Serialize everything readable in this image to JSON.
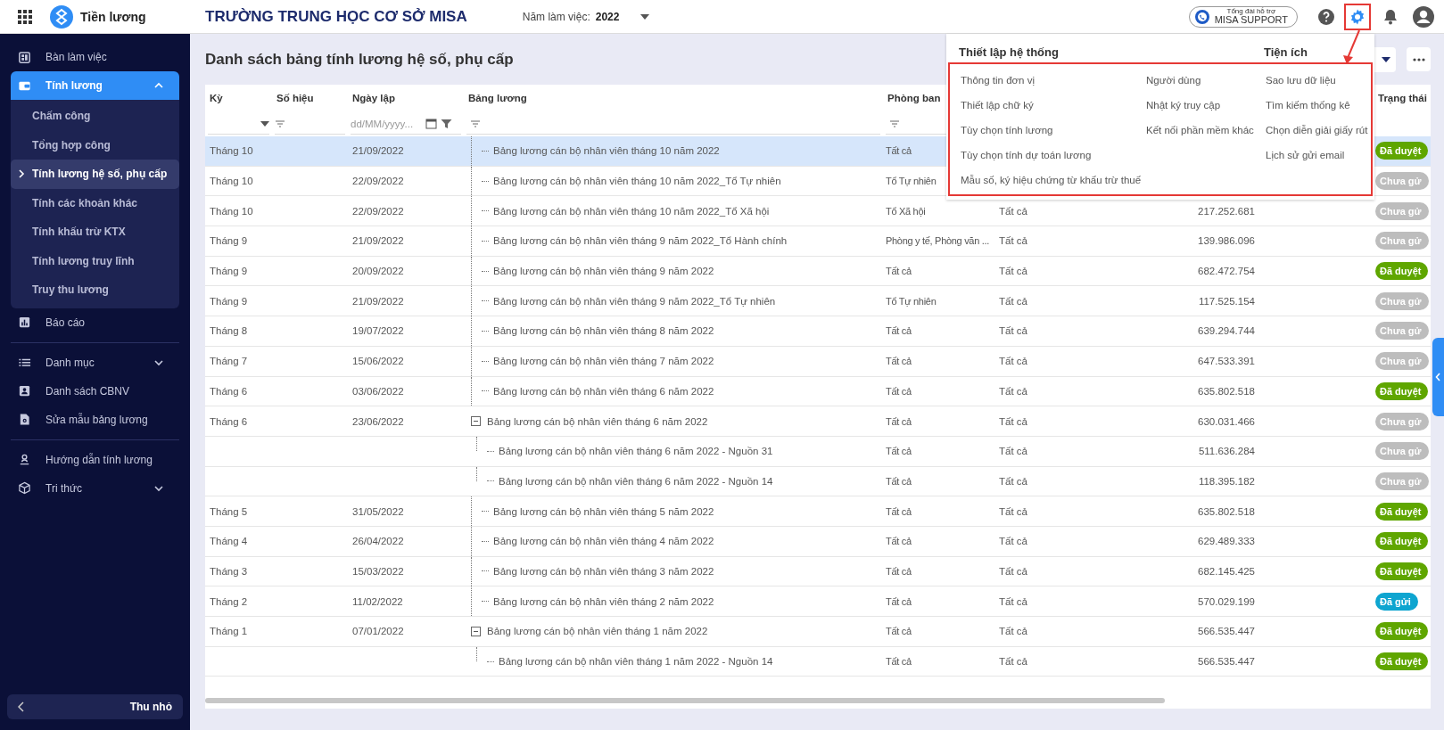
{
  "app_bar": {
    "app_name": "Tiền lương",
    "organization": "TRƯỜNG TRUNG HỌC CƠ SỞ MISA",
    "year_label": "Năm làm việc:",
    "year": "2022",
    "support": {
      "caption": "Tổng đài hỗ trợ",
      "label": "MISA SUPPORT"
    }
  },
  "sidebar": {
    "sections": [
      {
        "items": [
          {
            "label": "Bàn làm việc",
            "selected": false
          },
          {
            "label": "Tính lương",
            "selected": true,
            "expanded": true,
            "children": [
              {
                "label": "Chấm công",
                "selected": false
              },
              {
                "label": "Tổng hợp công",
                "selected": false
              },
              {
                "label": "Tính lương hệ số, phụ cấp",
                "selected": true
              },
              {
                "label": "Tính các khoản khác",
                "selected": false
              },
              {
                "label": "Tính khấu trừ KTX",
                "selected": false
              },
              {
                "label": "Tính lương truy lĩnh",
                "selected": false
              },
              {
                "label": "Truy thu lương",
                "selected": false
              }
            ]
          },
          {
            "label": "Báo cáo",
            "selected": false
          }
        ]
      },
      {
        "items": [
          {
            "label": "Danh mục",
            "selected": false,
            "expanded": false
          },
          {
            "label": "Danh sách CBNV",
            "selected": false
          },
          {
            "label": "Sửa mẫu bảng lương",
            "selected": false
          }
        ]
      },
      {
        "items": [
          {
            "label": "Hướng dẫn tính lương",
            "selected": false
          },
          {
            "label": "Tri thức",
            "selected": false,
            "expanded": false
          }
        ]
      }
    ],
    "collapse_label": "Thu nhỏ"
  },
  "page": {
    "title": "Danh sách bảng tính lương hệ số, phụ cấp"
  },
  "table": {
    "columns": [
      "Kỳ",
      "Số hiệu",
      "Ngày lập",
      "Bảng lương",
      "Phòng ban",
      "Trạng thái"
    ],
    "filters": {
      "date_placeholder": "dd/MM/yyyy..."
    },
    "rows": [
      {
        "period": "Tháng 10",
        "date": "21/09/2022",
        "name": "Bảng lương cán bộ nhân viên tháng 10 năm 2022",
        "department": "Tất cả",
        "status": {
          "label": "Đã duyệt",
          "color": "#5fa600"
        },
        "selected": true
      },
      {
        "period": "Tháng 10",
        "date": "22/09/2022",
        "name": "Bảng lương cán bộ nhân viên tháng 10 năm 2022_Tổ Tự nhiên",
        "department": "Tổ Tự nhiên",
        "status": {
          "label": "Chưa gử",
          "color": "#bdbdbd"
        },
        "selected": false
      },
      {
        "period": "Tháng 10",
        "date": "22/09/2022",
        "name": "Bảng lương cán bộ nhân viên tháng 10 năm 2022_Tổ Xã hội",
        "department": "Tổ Xã hội",
        "column_6": "Tất cả",
        "amount": "217.252.681",
        "status": {
          "label": "Chưa gử",
          "color": "#bdbdbd"
        },
        "selected": false
      },
      {
        "period": "Tháng 9",
        "date": "21/09/2022",
        "name": "Bảng lương cán bộ nhân viên tháng 9 năm 2022_Tổ Hành chính",
        "department": "Phòng y tế, Phòng văn ...",
        "column_6": "Tất cả",
        "amount": "139.986.096",
        "status": {
          "label": "Chưa gử",
          "color": "#bdbdbd"
        },
        "selected": false
      },
      {
        "period": "Tháng 9",
        "date": "20/09/2022",
        "name": "Bảng lương cán bộ nhân viên tháng 9 năm 2022",
        "department": "Tất cả",
        "column_6": "Tất cả",
        "amount": "682.472.754",
        "status": {
          "label": "Đã duyệt",
          "color": "#5fa600"
        },
        "selected": false
      },
      {
        "period": "Tháng 9",
        "date": "21/09/2022",
        "name": "Bảng lương cán bộ nhân viên tháng 9 năm 2022_Tổ Tự nhiên",
        "department": "Tổ Tự nhiên",
        "column_6": "Tất cả",
        "amount": "117.525.154",
        "status": {
          "label": "Chưa gử",
          "color": "#bdbdbd"
        },
        "selected": false
      },
      {
        "period": "Tháng 8",
        "date": "19/07/2022",
        "name": "Bảng lương cán bộ nhân viên tháng 8 năm 2022",
        "department": "Tất cả",
        "column_6": "Tất cả",
        "amount": "639.294.744",
        "status": {
          "label": "Chưa gử",
          "color": "#bdbdbd"
        },
        "selected": false
      },
      {
        "period": "Tháng 7",
        "date": "15/06/2022",
        "name": "Bảng lương cán bộ nhân viên tháng 7 năm 2022",
        "department": "Tất cả",
        "column_6": "Tất cả",
        "amount": "647.533.391",
        "status": {
          "label": "Chưa gử",
          "color": "#bdbdbd"
        },
        "selected": false
      },
      {
        "period": "Tháng 6",
        "date": "03/06/2022",
        "name": "Bảng lương cán bộ nhân viên tháng 6 năm 2022",
        "department": "Tất cả",
        "column_6": "Tất cả",
        "amount": "635.802.518",
        "status": {
          "label": "Đã duyệt",
          "color": "#5fa600"
        },
        "selected": false
      },
      {
        "period": "Tháng 6",
        "date": "23/06/2022",
        "name": "Bảng lương cán bộ nhân viên tháng 6 năm 2022",
        "department": "Tất cả",
        "column_6": "Tất cả",
        "amount": "630.031.466",
        "status": {
          "label": "Chưa gử",
          "color": "#bdbdbd"
        },
        "selected": false,
        "expanded": true,
        "children": [
          {
            "name": "Bảng lương cán bộ nhân viên tháng 6 năm 2022 - Nguồn 31",
            "department": "Tất cả",
            "column_6": "Tất cả",
            "amount": "511.636.284",
            "status": {
              "label": "Chưa gử",
              "color": "#bdbdbd"
            },
            "selected": false
          },
          {
            "name": "Bảng lương cán bộ nhân viên tháng 6 năm 2022 - Nguồn 14",
            "department": "Tất cả",
            "column_6": "Tất cả",
            "amount": "118.395.182",
            "status": {
              "label": "Chưa gử",
              "color": "#bdbdbd"
            },
            "selected": false
          }
        ]
      },
      {
        "period": "Tháng 5",
        "date": "31/05/2022",
        "name": "Bảng lương cán bộ nhân viên tháng 5 năm 2022",
        "department": "Tất cả",
        "column_6": "Tất cả",
        "amount": "635.802.518",
        "status": {
          "label": "Đã duyệt",
          "color": "#5fa600"
        },
        "selected": false
      },
      {
        "period": "Tháng 4",
        "date": "26/04/2022",
        "name": "Bảng lương cán bộ nhân viên tháng 4 năm 2022",
        "department": "Tất cả",
        "column_6": "Tất cả",
        "amount": "629.489.333",
        "status": {
          "label": "Đã duyệt",
          "color": "#5fa600"
        },
        "selected": false
      },
      {
        "period": "Tháng 3",
        "date": "15/03/2022",
        "name": "Bảng lương cán bộ nhân viên tháng 3 năm 2022",
        "department": "Tất cả",
        "column_6": "Tất cả",
        "amount": "682.145.425",
        "status": {
          "label": "Đã duyệt",
          "color": "#5fa600"
        },
        "selected": false
      },
      {
        "period": "Tháng 2",
        "date": "11/02/2022",
        "name": "Bảng lương cán bộ nhân viên tháng 2 năm 2022",
        "department": "Tất cả",
        "column_6": "Tất cả",
        "amount": "570.029.199",
        "status": {
          "label": "Đã gửi",
          "color": "#0ea5d0"
        },
        "selected": false
      },
      {
        "period": "Tháng 1",
        "date": "07/01/2022",
        "name": "Bảng lương cán bộ nhân viên tháng 1 năm 2022",
        "department": "Tất cả",
        "column_6": "Tất cả",
        "amount": "566.535.447",
        "status": {
          "label": "Đã duyệt",
          "color": "#5fa600"
        },
        "selected": false,
        "expanded": true,
        "children": [
          {
            "name": "Bảng lương cán bộ nhân viên tháng 1 năm 2022 - Nguồn 14",
            "department": "Tất cả",
            "column_6": "Tất cả",
            "amount": "566.535.447",
            "status": {
              "label": "Đã duyệt",
              "color": "#5fa600"
            },
            "selected": false
          }
        ]
      }
    ]
  },
  "settings_menu": {
    "groups": [
      {
        "title": "Thiết lập hệ thống",
        "columns": [
          [
            "Thông tin đơn vị",
            "Thiết lập chữ ký",
            "Tùy chọn tính lương",
            "Tùy chọn tính dự toán lương",
            "Mẫu số, ký hiệu chứng từ khấu trừ thuế"
          ],
          [
            "Người dùng",
            "Nhật ký truy cập",
            "Kết nối phần mềm khác"
          ]
        ]
      },
      {
        "title": "Tiện ích",
        "columns": [
          [
            "Sao lưu dữ liệu",
            "Tìm kiếm thống kê",
            "Chọn diễn giải giấy rút",
            "Lịch sử gửi email"
          ]
        ]
      }
    ]
  }
}
